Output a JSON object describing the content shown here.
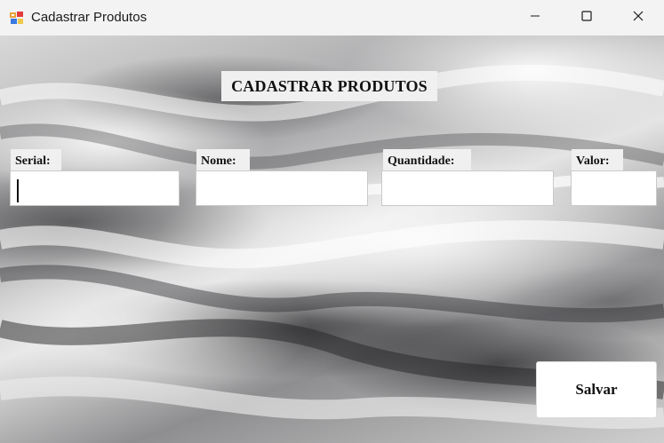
{
  "window": {
    "title": "Cadastrar Produtos",
    "icon": "winforms-app-icon",
    "controls": [
      "minimize-icon",
      "maximize-icon",
      "close-icon"
    ]
  },
  "form": {
    "heading": "CADASTRAR PRODUTOS",
    "fields": [
      {
        "label": "Serial:",
        "value": ""
      },
      {
        "label": "Nome:",
        "value": ""
      },
      {
        "label": "Quantidade:",
        "value": ""
      },
      {
        "label": "Valor:",
        "value": ""
      }
    ],
    "save_label": "Salvar"
  },
  "colors": {
    "titlebar": "#f3f3f3",
    "label_bg": "#f0f0f0",
    "text": "#111111"
  }
}
